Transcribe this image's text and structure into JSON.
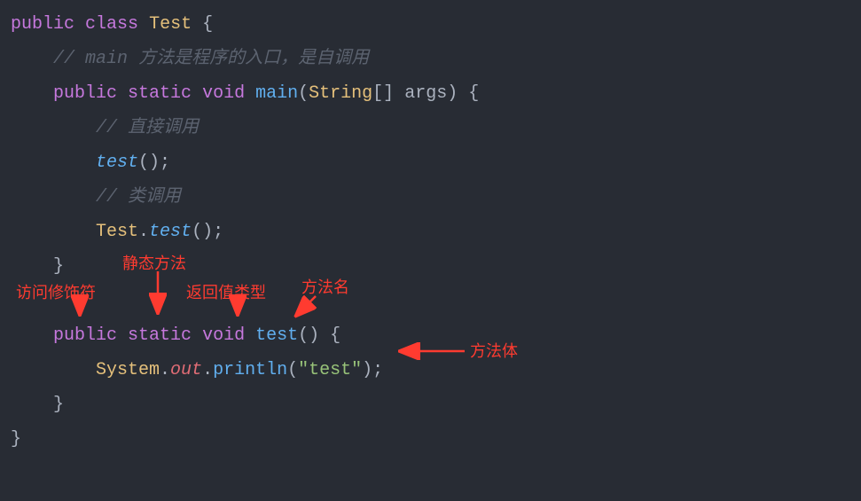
{
  "code": {
    "l1_public": "public",
    "l1_class": "class",
    "l1_name": "Test",
    "l1_brace": "{",
    "l2_slashes": "//",
    "l2_main": "main",
    "l2_comment": "方法是程序的入口，是自调用",
    "l3_public": "public",
    "l3_static": "static",
    "l3_void": "void",
    "l3_main": "main",
    "l3_paren_open": "(",
    "l3_string": "String",
    "l3_brackets": "[]",
    "l3_args": "args",
    "l3_paren_close": ")",
    "l3_brace": "{",
    "l4_slashes": "//",
    "l4_comment": "直接调用",
    "l5_test": "test",
    "l5_parens": "()",
    "l5_semi": ";",
    "l6_slashes": "//",
    "l6_comment": "类调用",
    "l7_Test": "Test",
    "l7_dot": ".",
    "l7_test": "test",
    "l7_parens": "()",
    "l7_semi": ";",
    "l8_brace": "}",
    "l9_public": "public",
    "l9_static": "static",
    "l9_void": "void",
    "l9_test": "test",
    "l9_parens": "()",
    "l9_brace": "{",
    "l10_System": "System",
    "l10_dot1": ".",
    "l10_out": "out",
    "l10_dot2": ".",
    "l10_println": "println",
    "l10_paren_open": "(",
    "l10_str": "\"test\"",
    "l10_paren_close": ")",
    "l10_semi": ";",
    "l11_brace": "}",
    "l12_brace": "}"
  },
  "annotations": {
    "access_modifier": "访问修饰符",
    "static_method": "静态方法",
    "return_type": "返回值类型",
    "method_name": "方法名",
    "method_body": "方法体"
  }
}
